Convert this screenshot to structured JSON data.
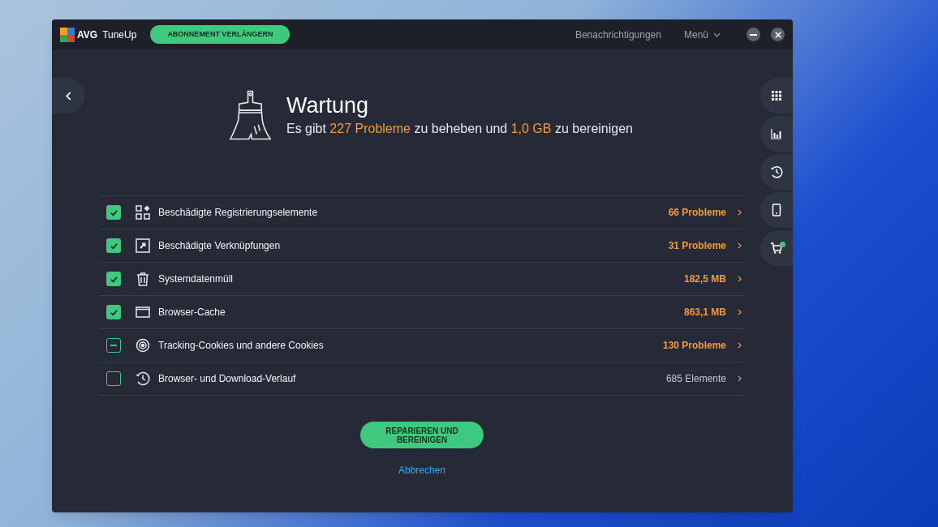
{
  "window": {
    "brand": "AVG",
    "product": "TuneUp",
    "renew_button": "ABONNEMENT VERLÄNGERN",
    "notifications": "Benachrichtigungen",
    "menu": "Menü"
  },
  "header": {
    "title": "Wartung",
    "subtitle_parts": [
      {
        "text": "Es gibt ",
        "highlight": false
      },
      {
        "text": "227 Probleme",
        "highlight": true
      },
      {
        "text": " zu beheben und ",
        "highlight": false
      },
      {
        "text": "1,0 GB",
        "highlight": true
      },
      {
        "text": " zu bereinigen",
        "highlight": false
      }
    ]
  },
  "items": [
    {
      "kind": "registry",
      "label": "Beschädigte Registrierungselemente",
      "value": "66 Probleme",
      "highlight": true,
      "checked": true,
      "mixed": false
    },
    {
      "kind": "shortcut",
      "label": "Beschädigte Verknüpfungen",
      "value": "31 Probleme",
      "highlight": true,
      "checked": true,
      "mixed": false
    },
    {
      "kind": "trash",
      "label": "Systemdatenmüll",
      "value": "182,5 MB",
      "highlight": true,
      "checked": true,
      "mixed": false
    },
    {
      "kind": "browser",
      "label": "Browser-Cache",
      "value": "863,1 MB",
      "highlight": true,
      "checked": true,
      "mixed": false
    },
    {
      "kind": "target",
      "label": "Tracking-Cookies und andere Cookies",
      "value": "130 Probleme",
      "highlight": true,
      "checked": false,
      "mixed": true
    },
    {
      "kind": "history",
      "label": "Browser- und Download-Verlauf",
      "value": "685 Elemente",
      "highlight": false,
      "checked": false,
      "mixed": false
    }
  ],
  "primary_button": "REPARIEREN UND BEREINIGEN",
  "cancel_link": "Abbrechen",
  "side_rail": [
    {
      "kind": "grid",
      "badge": false
    },
    {
      "kind": "chart",
      "badge": false
    },
    {
      "kind": "history",
      "badge": false
    },
    {
      "kind": "phone",
      "badge": false
    },
    {
      "kind": "cart",
      "badge": true
    }
  ]
}
